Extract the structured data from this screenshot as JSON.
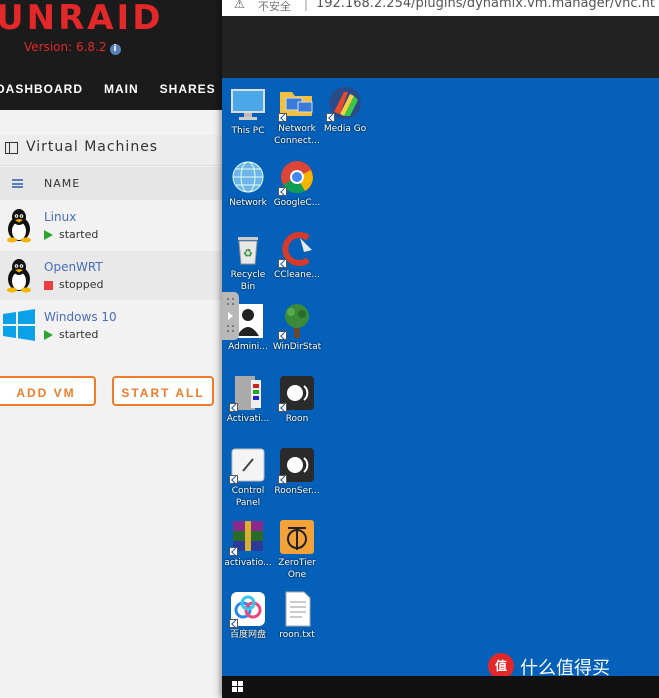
{
  "unraid": {
    "logo": "UNRAID",
    "version": "Version: 6.8.2",
    "nav": [
      "DASHBOARD",
      "MAIN",
      "SHARES"
    ],
    "section_title": "Virtual Machines",
    "column_name": "NAME",
    "vms": [
      {
        "name": "Linux",
        "status": "started",
        "os": "linux"
      },
      {
        "name": "OpenWRT",
        "status": "stopped",
        "os": "linux"
      },
      {
        "name": "Windows 10",
        "status": "started",
        "os": "windows"
      }
    ],
    "buttons": {
      "add_vm": "ADD VM",
      "start_all": "START ALL"
    },
    "colors": {
      "accent": "#ef7b2b",
      "brand_red": "#e22828",
      "link": "#486dba"
    }
  },
  "browser": {
    "insecure_label": "不安全",
    "url": "192.168.2.254/plugins/dynamix.vm.manager/vnc.ht"
  },
  "desktop": {
    "icons": [
      {
        "label": "This PC",
        "icon": "monitor-icon"
      },
      {
        "label": "Network Connect...",
        "icon": "network-connections-icon"
      },
      {
        "label": "Media Go",
        "icon": "media-go-icon"
      },
      {
        "label": "Network",
        "icon": "network-globe-icon"
      },
      {
        "label": "GoogleC...",
        "icon": "chrome-icon"
      },
      {
        "label": "Recycle Bin",
        "icon": "recycle-bin-icon"
      },
      {
        "label": "CCleane...",
        "icon": "ccleaner-icon"
      },
      {
        "label": "Admini...",
        "icon": "user-icon"
      },
      {
        "label": "WinDirStat",
        "icon": "windirstat-icon"
      },
      {
        "label": "Activati...",
        "icon": "activation-icon"
      },
      {
        "label": "Roon",
        "icon": "roon-icon"
      },
      {
        "label": "Control Panel",
        "icon": "control-panel-icon"
      },
      {
        "label": "RoonSer...",
        "icon": "roon-server-icon"
      },
      {
        "label": "activatio...",
        "icon": "winrar-icon"
      },
      {
        "label": "ZeroTier One",
        "icon": "zerotier-icon"
      },
      {
        "label": "百度网盘",
        "icon": "baidu-netdisk-icon"
      },
      {
        "label": "roon.txt",
        "icon": "text-file-icon"
      }
    ]
  },
  "watermark": {
    "badge": "值",
    "text": "什么值得买"
  }
}
